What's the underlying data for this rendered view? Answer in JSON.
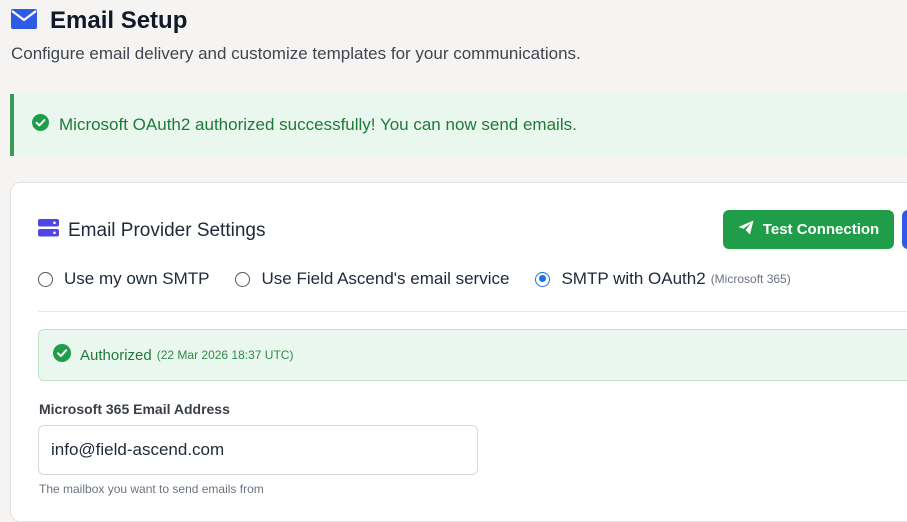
{
  "header": {
    "icon": "envelope-icon",
    "title": "Email Setup",
    "subtitle": "Configure email delivery and customize templates for your communications."
  },
  "alert": {
    "icon": "check-circle-icon",
    "message": "Microsoft OAuth2 authorized successfully! You can now send emails."
  },
  "provider_card": {
    "icon": "server-icon",
    "title": "Email Provider Settings",
    "test_button": {
      "icon": "paper-plane-icon",
      "label": "Test Connection"
    },
    "options": [
      {
        "label": "Use my own SMTP",
        "note": "",
        "selected": false
      },
      {
        "label": "Use Field Ascend's email service",
        "note": "",
        "selected": false
      },
      {
        "label": "SMTP with OAuth2",
        "note": "(Microsoft 365)",
        "selected": true
      }
    ],
    "auth_status": {
      "icon": "check-circle-icon",
      "label": "Authorized",
      "date": "(22 Mar 2026 18:37 UTC)"
    },
    "email_field": {
      "label": "Microsoft 365 Email Address",
      "value": "info@field-ascend.com",
      "help": "The mailbox you want to send emails from"
    }
  },
  "colors": {
    "success_green": "#1f9d48",
    "success_bg": "#eaf7ee",
    "primary_blue": "#2d5be3",
    "accent_indigo": "#4f46e5"
  }
}
